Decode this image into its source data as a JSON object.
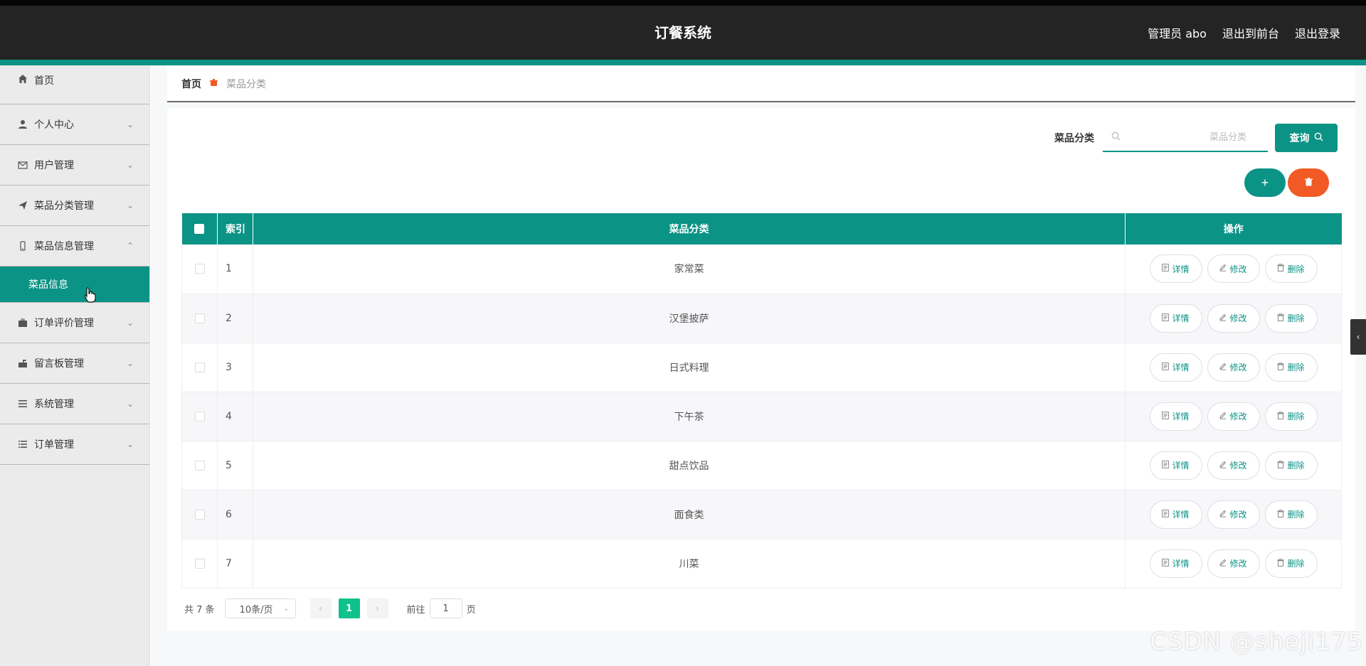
{
  "header": {
    "title": "订餐系统",
    "admin_label": "管理员 abo",
    "front_label": "退出到前台",
    "logout_label": "退出登录"
  },
  "sidebar": {
    "items": [
      {
        "label": "首页",
        "icon": "home-icon"
      },
      {
        "label": "个人中心",
        "icon": "user-icon"
      },
      {
        "label": "用户管理",
        "icon": "mail-icon"
      },
      {
        "label": "菜品分类管理",
        "icon": "send-icon"
      },
      {
        "label": "菜品信息管理",
        "icon": "phone-icon"
      },
      {
        "label": "订单评价管理",
        "icon": "briefcase-icon"
      },
      {
        "label": "留言板管理",
        "icon": "mailbox-icon"
      },
      {
        "label": "系统管理",
        "icon": "menu-icon"
      },
      {
        "label": "订单管理",
        "icon": "list-icon"
      }
    ],
    "submenu_label": "菜品信息"
  },
  "breadcrumb": {
    "home": "首页",
    "current": "菜品分类"
  },
  "search": {
    "label": "菜品分类",
    "placeholder": "菜品分类",
    "button": "查询"
  },
  "table": {
    "headers": [
      "索引",
      "菜品分类",
      "操作"
    ],
    "rows": [
      {
        "index": "1",
        "category": "家常菜"
      },
      {
        "index": "2",
        "category": "汉堡披萨"
      },
      {
        "index": "3",
        "category": "日式料理"
      },
      {
        "index": "4",
        "category": "下午茶"
      },
      {
        "index": "5",
        "category": "甜点饮品"
      },
      {
        "index": "6",
        "category": "面食类"
      },
      {
        "index": "7",
        "category": "川菜"
      }
    ],
    "ops": {
      "detail": "详情",
      "edit": "修改",
      "delete": "删除"
    }
  },
  "pagination": {
    "total": "共 7 条",
    "page_size": "10条/页",
    "current_page": "1",
    "goto_label": "前往",
    "goto_value": "1",
    "page_suffix": "页"
  },
  "watermark": "CSDN @sheji175",
  "colors": {
    "primary": "#0b9386",
    "danger": "#f15a24",
    "header_bg": "#242424",
    "page_active": "#0fc28d"
  }
}
